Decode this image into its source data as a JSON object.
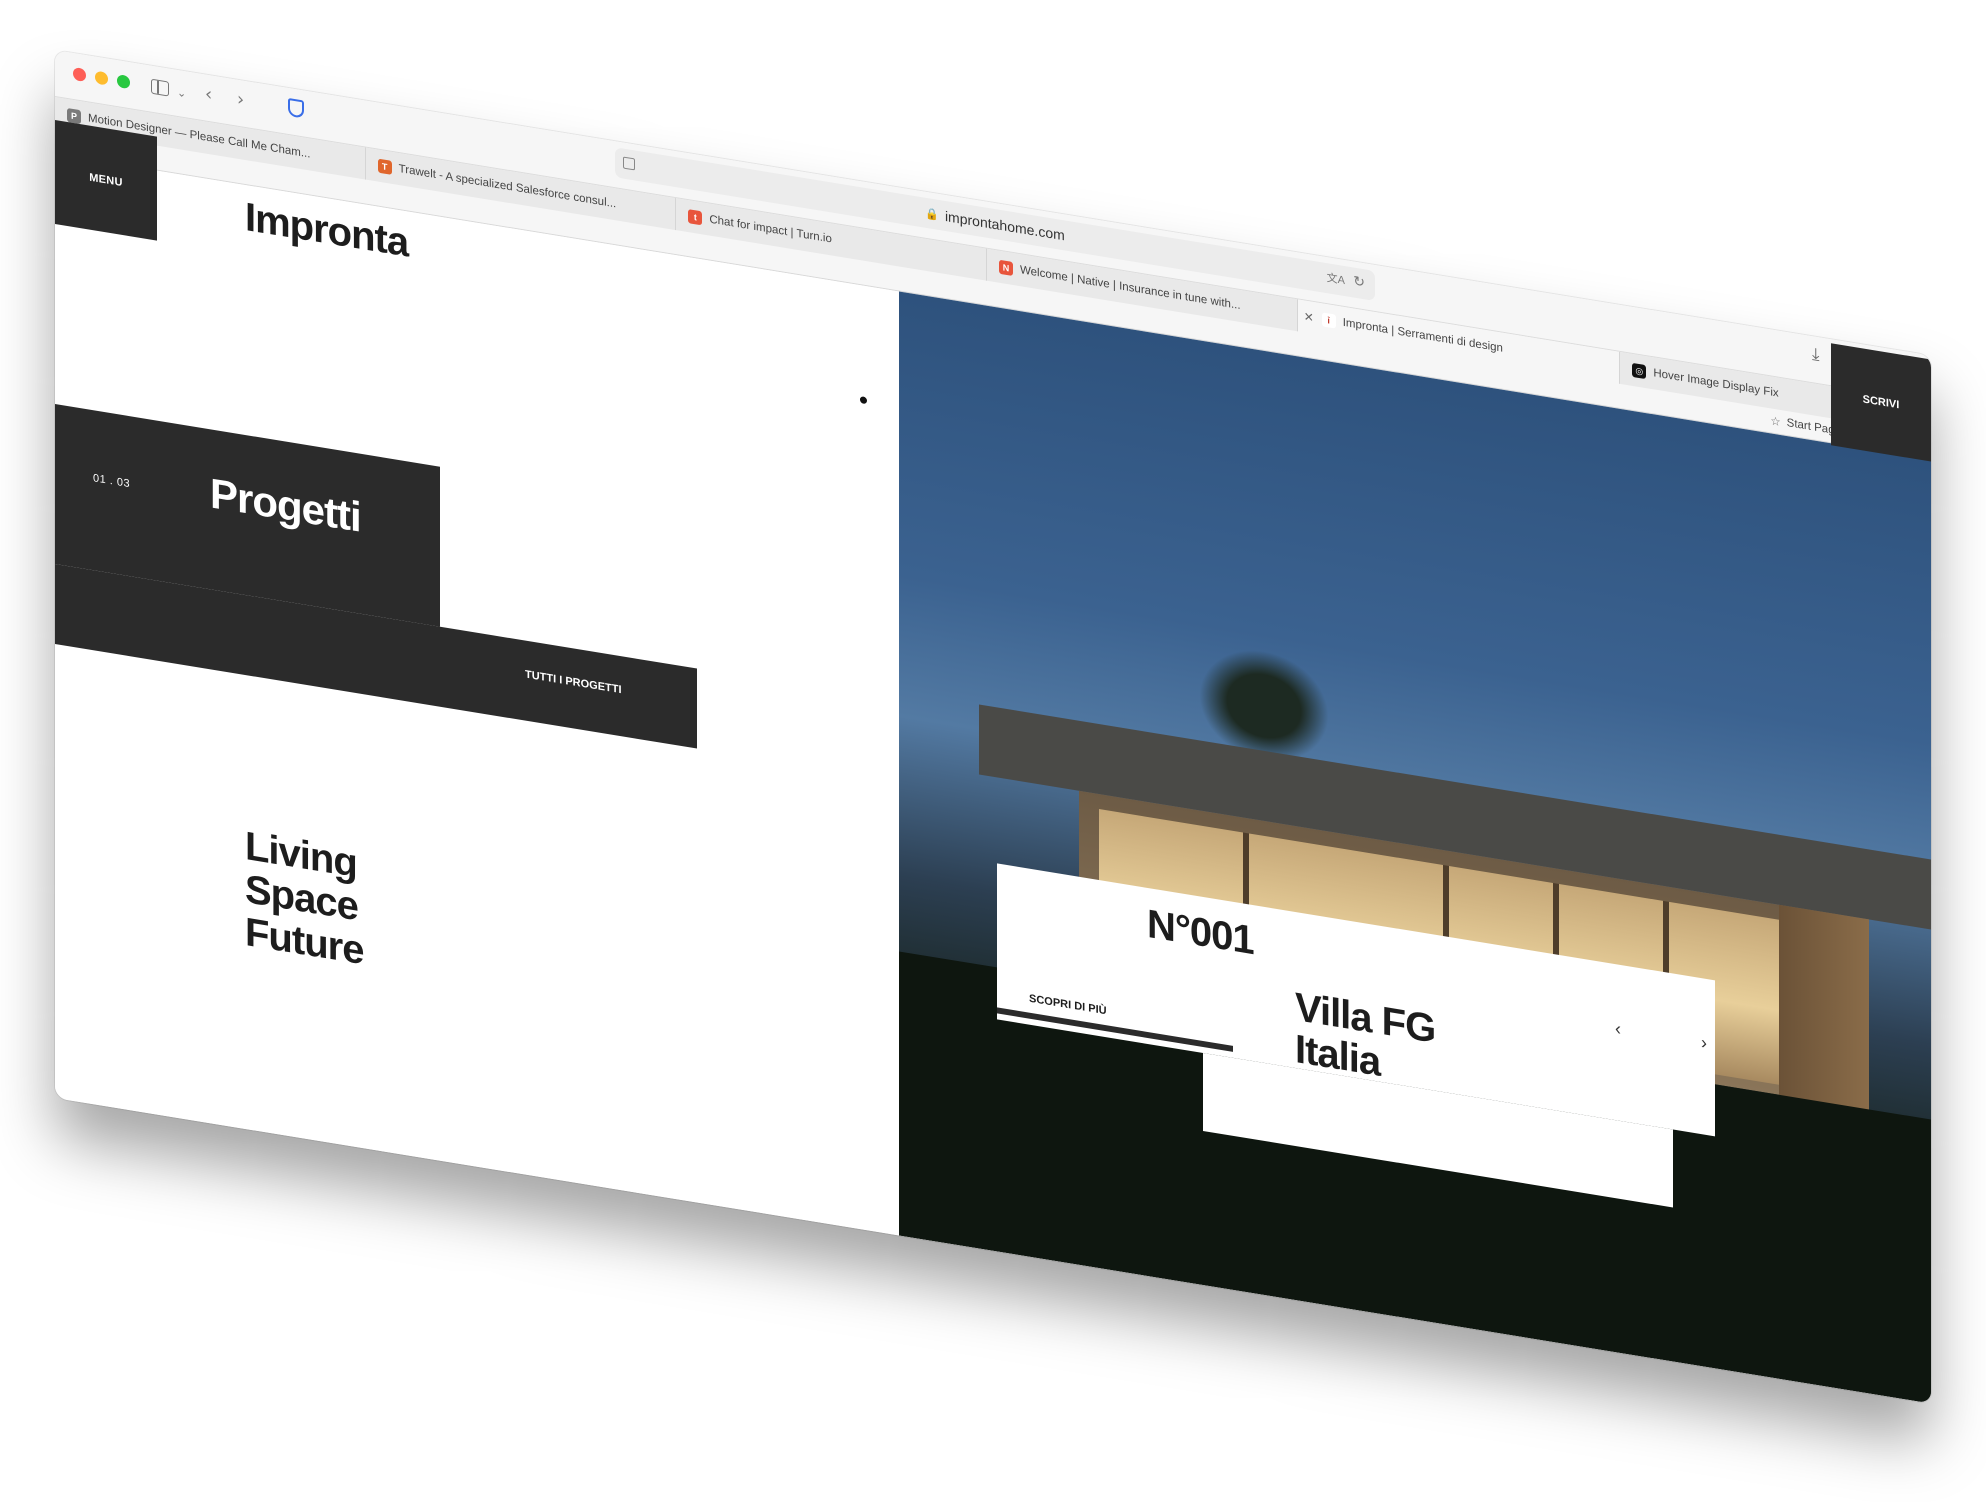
{
  "browser": {
    "url": "improntahome.com",
    "tabs": [
      {
        "label": "Motion Designer — Please Call Me Cham...",
        "favicon": "P",
        "color": "#7a7a7a"
      },
      {
        "label": "Trawelt - A specialized Salesforce consul...",
        "favicon": "T",
        "color": "#e0662c"
      },
      {
        "label": "Chat for impact | Turn.io",
        "favicon": "t",
        "color": "#e8553c"
      },
      {
        "label": "Welcome | Native | Insurance in tune with...",
        "favicon": "N",
        "color": "#e8553c"
      },
      {
        "label": "Impronta | Serramenti di design",
        "favicon": "ỉ",
        "color": "#ffffff",
        "active": true
      },
      {
        "label": "Hover Image Display Fix",
        "favicon": "◎",
        "color": "#111111"
      }
    ],
    "bookmark": "Start Page"
  },
  "site": {
    "menu_label": "MENU",
    "logo": "Impronta",
    "counter": "01 . 03",
    "section_title": "Progetti",
    "all_projects": "TUTTI I PROGETTI",
    "slogan": [
      "Living",
      "Space",
      "Future"
    ],
    "write_label": "SCRIVI"
  },
  "project": {
    "number": "N°001",
    "name_line1": "Villa FG",
    "name_line2": "Italia",
    "discover": "SCOPRI DI PIÙ",
    "prev": "‹",
    "next": "›"
  }
}
